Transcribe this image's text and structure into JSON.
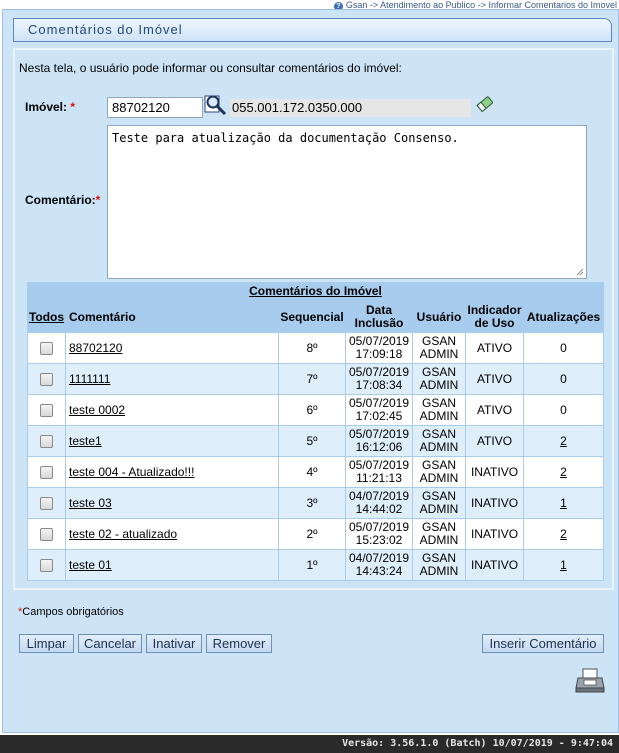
{
  "breadcrumb": "Gsan -> Atendimento ao Publico -> Informar Comentarios do Imovel",
  "title": "Comentários do Imóvel",
  "intro": "Nesta tela, o usuário pode informar ou consultar comentários do imóvel:",
  "form": {
    "imovel_label": "Imóvel:",
    "imovel_value": "88702120",
    "imovel_desc": "055.001.172.0350.000",
    "comentario_label": "Comentário:",
    "comentario_value": "Teste para atualização da documentação Consenso.",
    "required_mark": "*"
  },
  "grid": {
    "caption": "Comentários do Imóvel",
    "headers": {
      "todos": "Todos",
      "comentario": "Comentário",
      "sequencial": "Sequencial",
      "data1": "Data",
      "data2": "Inclusão",
      "usuario": "Usuário",
      "indicador1": "Indicador",
      "indicador2": "de Uso",
      "atualizacoes": "Atualizações"
    },
    "rows": [
      {
        "comentario": "88702120",
        "seq": "8º",
        "date": "05/07/2019",
        "time": "17:09:18",
        "user1": "GSAN",
        "user2": "ADMIN",
        "ind": "ATIVO",
        "atu": "0"
      },
      {
        "comentario": "1111111",
        "seq": "7º",
        "date": "05/07/2019",
        "time": "17:08:34",
        "user1": "GSAN",
        "user2": "ADMIN",
        "ind": "ATIVO",
        "atu": "0"
      },
      {
        "comentario": "teste 0002",
        "seq": "6º",
        "date": "05/07/2019",
        "time": "17:02:45",
        "user1": "GSAN",
        "user2": "ADMIN",
        "ind": "ATIVO",
        "atu": "0"
      },
      {
        "comentario": "teste1",
        "seq": "5º",
        "date": "05/07/2019",
        "time": "16:12:06",
        "user1": "GSAN",
        "user2": "ADMIN",
        "ind": "ATIVO",
        "atu": "2"
      },
      {
        "comentario": "teste 004 - Atualizado!!!",
        "seq": "4º",
        "date": "05/07/2019",
        "time": "11:21:13",
        "user1": "GSAN",
        "user2": "ADMIN",
        "ind": "INATIVO",
        "atu": "2"
      },
      {
        "comentario": "teste 03",
        "seq": "3º",
        "date": "04/07/2019",
        "time": "14:44:02",
        "user1": "GSAN",
        "user2": "ADMIN",
        "ind": "INATIVO",
        "atu": "1"
      },
      {
        "comentario": "teste 02 - atualizado",
        "seq": "2º",
        "date": "05/07/2019",
        "time": "15:23:02",
        "user1": "GSAN",
        "user2": "ADMIN",
        "ind": "INATIVO",
        "atu": "2"
      },
      {
        "comentario": "teste 01",
        "seq": "1º",
        "date": "04/07/2019",
        "time": "14:43:24",
        "user1": "GSAN",
        "user2": "ADMIN",
        "ind": "INATIVO",
        "atu": "1"
      }
    ]
  },
  "required_note": "Campos obrigatórios",
  "buttons": {
    "limpar": "Limpar",
    "cancelar": "Cancelar",
    "inativar": "Inativar",
    "remover": "Remover",
    "inserir": "Inserir Comentário"
  },
  "version": "Versão: 3.56.1.0 (Batch) 10/07/2019 - 9:47:04"
}
